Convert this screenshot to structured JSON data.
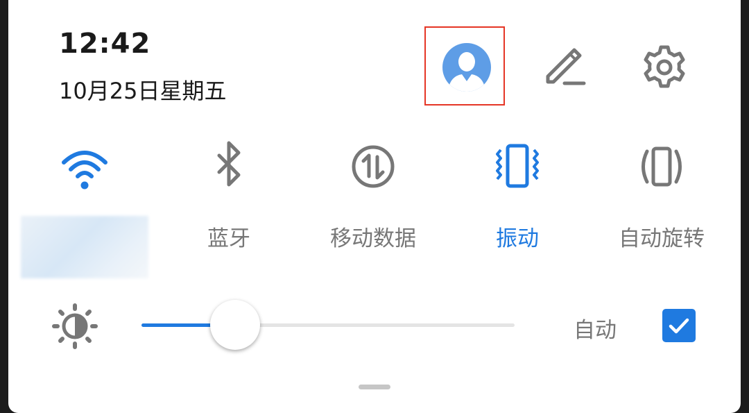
{
  "status": {
    "time": "12:42",
    "date": "10月25日星期五"
  },
  "header_icons": {
    "avatar": "avatar-icon",
    "edit": "edit-pencil-icon",
    "settings": "gear-icon"
  },
  "tiles": [
    {
      "label": "",
      "icon": "wifi-icon",
      "active": true
    },
    {
      "label": "蓝牙",
      "icon": "bluetooth-icon",
      "active": false
    },
    {
      "label": "移动数据",
      "icon": "mobile-data-icon",
      "active": false
    },
    {
      "label": "振动",
      "icon": "vibrate-icon",
      "active": true
    },
    {
      "label": "自动旋转",
      "icon": "auto-rotate-icon",
      "active": false
    }
  ],
  "brightness": {
    "icon": "brightness-icon",
    "level": 0.25,
    "auto_label": "自动",
    "auto_checked": true
  },
  "colors": {
    "accent": "#1f7ae0",
    "inactive": "#777777",
    "highlight_border": "#e53525"
  }
}
